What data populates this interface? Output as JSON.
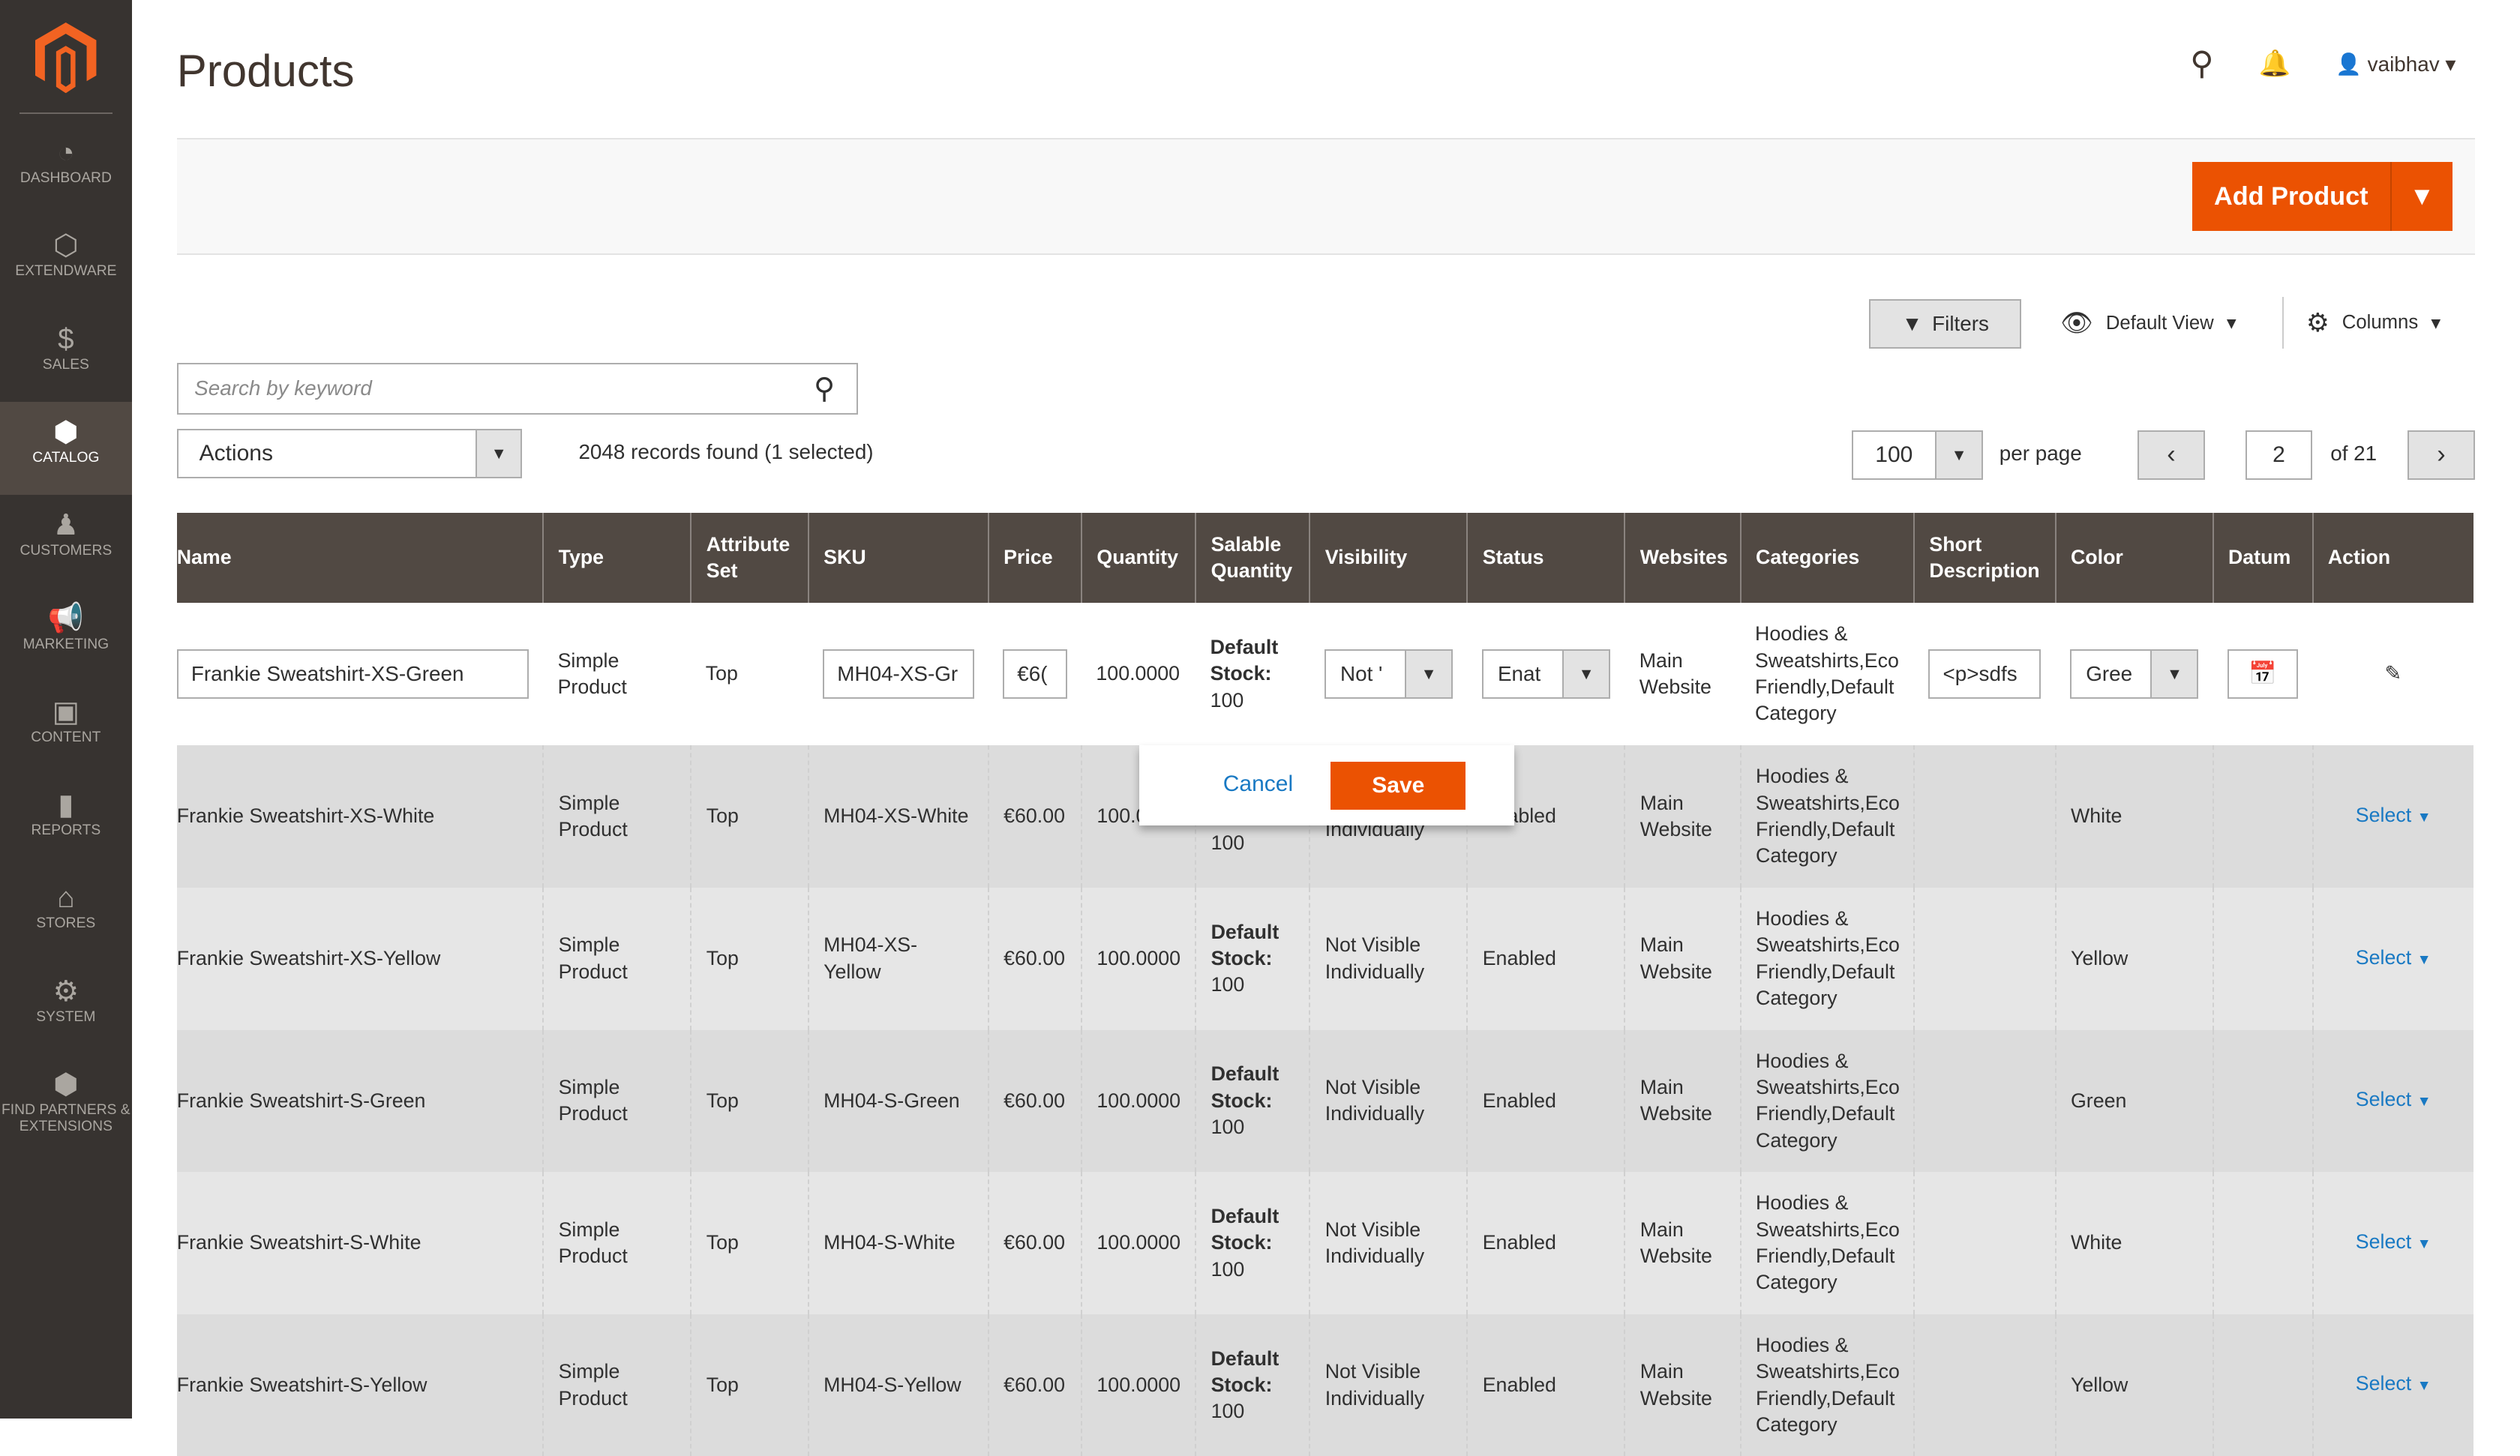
{
  "colors": {
    "accent": "#eb5202",
    "sidebar": "#373330",
    "header": "#514943",
    "link": "#1979c3"
  },
  "sidebar": {
    "items": [
      {
        "label": "DASHBOARD",
        "icon": "dashboard-icon"
      },
      {
        "label": "EXTENDWARE",
        "icon": "hexagon-icon"
      },
      {
        "label": "SALES",
        "icon": "dollar-icon"
      },
      {
        "label": "CATALOG",
        "icon": "box-icon",
        "active": true
      },
      {
        "label": "CUSTOMERS",
        "icon": "person-icon"
      },
      {
        "label": "MARKETING",
        "icon": "megaphone-icon"
      },
      {
        "label": "CONTENT",
        "icon": "layout-icon"
      },
      {
        "label": "REPORTS",
        "icon": "bar-chart-icon"
      },
      {
        "label": "STORES",
        "icon": "store-icon"
      },
      {
        "label": "SYSTEM",
        "icon": "gear-icon"
      },
      {
        "label": "FIND PARTNERS & EXTENSIONS",
        "icon": "partners-icon"
      }
    ]
  },
  "header": {
    "title": "Products",
    "user": "vaibhav"
  },
  "toolbar": {
    "add_product": "Add Product",
    "filters": "Filters",
    "view": "Default View",
    "columns": "Columns",
    "search_placeholder": "Search by keyword",
    "actions": "Actions",
    "records": "2048 records found (1 selected)",
    "per_page_value": "100",
    "per_page_label": "per page",
    "page": "2",
    "of_pages": "of 21"
  },
  "table": {
    "columns": [
      "Name",
      "Type",
      "Attribute Set",
      "SKU",
      "Price",
      "Quantity",
      "Salable Quantity",
      "Visibility",
      "Status",
      "Websites",
      "Categories",
      "Short Description",
      "Color",
      "Datum",
      "Action"
    ],
    "edit_row": {
      "name": "Frankie  Sweatshirt-XS-Green",
      "type": "Simple Product",
      "attr": "Top",
      "sku": "MH04-XS-Gr",
      "price": "€6(",
      "qty": "100.0000",
      "salable_label": "Default Stock:",
      "salable_value": "100",
      "visibility": "Not '",
      "status": "Enat",
      "websites": "Main Website",
      "categories": "Hoodies & Sweatshirts,Eco Friendly,Default Category",
      "short_desc": "<p>sdfs",
      "color": "Gree"
    },
    "rows": [
      {
        "name": "Frankie  Sweatshirt-XS-White",
        "type": "Simple Product",
        "attr": "Top",
        "sku": "MH04-XS-White",
        "price": "€60.00",
        "qty": "100.0000",
        "salable_label": "Default Stock:",
        "salable_value": "100",
        "visibility": "Not Visible Individually",
        "status": "Enabled",
        "websites": "Main Website",
        "categories": "Hoodies & Sweatshirts,Eco Friendly,Default Category",
        "color": "White",
        "action": "Select"
      },
      {
        "name": "Frankie  Sweatshirt-XS-Yellow",
        "type": "Simple Product",
        "attr": "Top",
        "sku": "MH04-XS-Yellow",
        "price": "€60.00",
        "qty": "100.0000",
        "salable_label": "Default Stock:",
        "salable_value": "100",
        "visibility": "Not Visible Individually",
        "status": "Enabled",
        "websites": "Main Website",
        "categories": "Hoodies & Sweatshirts,Eco Friendly,Default Category",
        "color": "Yellow",
        "action": "Select"
      },
      {
        "name": "Frankie  Sweatshirt-S-Green",
        "type": "Simple Product",
        "attr": "Top",
        "sku": "MH04-S-Green",
        "price": "€60.00",
        "qty": "100.0000",
        "salable_label": "Default Stock:",
        "salable_value": "100",
        "visibility": "Not Visible Individually",
        "status": "Enabled",
        "websites": "Main Website",
        "categories": "Hoodies & Sweatshirts,Eco Friendly,Default Category",
        "color": "Green",
        "action": "Select"
      },
      {
        "name": "Frankie  Sweatshirt-S-White",
        "type": "Simple Product",
        "attr": "Top",
        "sku": "MH04-S-White",
        "price": "€60.00",
        "qty": "100.0000",
        "salable_label": "Default Stock:",
        "salable_value": "100",
        "visibility": "Not Visible Individually",
        "status": "Enabled",
        "websites": "Main Website",
        "categories": "Hoodies & Sweatshirts,Eco Friendly,Default Category",
        "color": "White",
        "action": "Select"
      },
      {
        "name": "Frankie  Sweatshirt-S-Yellow",
        "type": "Simple Product",
        "attr": "Top",
        "sku": "MH04-S-Yellow",
        "price": "€60.00",
        "qty": "100.0000",
        "salable_label": "Default Stock:",
        "salable_value": "100",
        "visibility": "Not Visible Individually",
        "status": "Enabled",
        "websites": "Main Website",
        "categories": "Hoodies & Sweatshirts,Eco Friendly,Default Category",
        "color": "Yellow",
        "action": "Select"
      }
    ]
  },
  "popup": {
    "cancel": "Cancel",
    "save": "Save"
  }
}
